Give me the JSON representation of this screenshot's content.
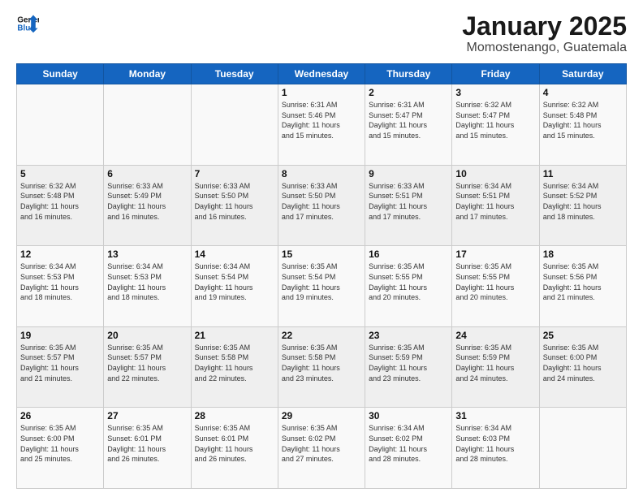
{
  "header": {
    "logo_line1": "General",
    "logo_line2": "Blue",
    "month_title": "January 2025",
    "location": "Momostenango, Guatemala"
  },
  "weekdays": [
    "Sunday",
    "Monday",
    "Tuesday",
    "Wednesday",
    "Thursday",
    "Friday",
    "Saturday"
  ],
  "weeks": [
    [
      {
        "day": "",
        "info": ""
      },
      {
        "day": "",
        "info": ""
      },
      {
        "day": "",
        "info": ""
      },
      {
        "day": "1",
        "info": "Sunrise: 6:31 AM\nSunset: 5:46 PM\nDaylight: 11 hours\nand 15 minutes."
      },
      {
        "day": "2",
        "info": "Sunrise: 6:31 AM\nSunset: 5:47 PM\nDaylight: 11 hours\nand 15 minutes."
      },
      {
        "day": "3",
        "info": "Sunrise: 6:32 AM\nSunset: 5:47 PM\nDaylight: 11 hours\nand 15 minutes."
      },
      {
        "day": "4",
        "info": "Sunrise: 6:32 AM\nSunset: 5:48 PM\nDaylight: 11 hours\nand 15 minutes."
      }
    ],
    [
      {
        "day": "5",
        "info": "Sunrise: 6:32 AM\nSunset: 5:48 PM\nDaylight: 11 hours\nand 16 minutes."
      },
      {
        "day": "6",
        "info": "Sunrise: 6:33 AM\nSunset: 5:49 PM\nDaylight: 11 hours\nand 16 minutes."
      },
      {
        "day": "7",
        "info": "Sunrise: 6:33 AM\nSunset: 5:50 PM\nDaylight: 11 hours\nand 16 minutes."
      },
      {
        "day": "8",
        "info": "Sunrise: 6:33 AM\nSunset: 5:50 PM\nDaylight: 11 hours\nand 17 minutes."
      },
      {
        "day": "9",
        "info": "Sunrise: 6:33 AM\nSunset: 5:51 PM\nDaylight: 11 hours\nand 17 minutes."
      },
      {
        "day": "10",
        "info": "Sunrise: 6:34 AM\nSunset: 5:51 PM\nDaylight: 11 hours\nand 17 minutes."
      },
      {
        "day": "11",
        "info": "Sunrise: 6:34 AM\nSunset: 5:52 PM\nDaylight: 11 hours\nand 18 minutes."
      }
    ],
    [
      {
        "day": "12",
        "info": "Sunrise: 6:34 AM\nSunset: 5:53 PM\nDaylight: 11 hours\nand 18 minutes."
      },
      {
        "day": "13",
        "info": "Sunrise: 6:34 AM\nSunset: 5:53 PM\nDaylight: 11 hours\nand 18 minutes."
      },
      {
        "day": "14",
        "info": "Sunrise: 6:34 AM\nSunset: 5:54 PM\nDaylight: 11 hours\nand 19 minutes."
      },
      {
        "day": "15",
        "info": "Sunrise: 6:35 AM\nSunset: 5:54 PM\nDaylight: 11 hours\nand 19 minutes."
      },
      {
        "day": "16",
        "info": "Sunrise: 6:35 AM\nSunset: 5:55 PM\nDaylight: 11 hours\nand 20 minutes."
      },
      {
        "day": "17",
        "info": "Sunrise: 6:35 AM\nSunset: 5:55 PM\nDaylight: 11 hours\nand 20 minutes."
      },
      {
        "day": "18",
        "info": "Sunrise: 6:35 AM\nSunset: 5:56 PM\nDaylight: 11 hours\nand 21 minutes."
      }
    ],
    [
      {
        "day": "19",
        "info": "Sunrise: 6:35 AM\nSunset: 5:57 PM\nDaylight: 11 hours\nand 21 minutes."
      },
      {
        "day": "20",
        "info": "Sunrise: 6:35 AM\nSunset: 5:57 PM\nDaylight: 11 hours\nand 22 minutes."
      },
      {
        "day": "21",
        "info": "Sunrise: 6:35 AM\nSunset: 5:58 PM\nDaylight: 11 hours\nand 22 minutes."
      },
      {
        "day": "22",
        "info": "Sunrise: 6:35 AM\nSunset: 5:58 PM\nDaylight: 11 hours\nand 23 minutes."
      },
      {
        "day": "23",
        "info": "Sunrise: 6:35 AM\nSunset: 5:59 PM\nDaylight: 11 hours\nand 23 minutes."
      },
      {
        "day": "24",
        "info": "Sunrise: 6:35 AM\nSunset: 5:59 PM\nDaylight: 11 hours\nand 24 minutes."
      },
      {
        "day": "25",
        "info": "Sunrise: 6:35 AM\nSunset: 6:00 PM\nDaylight: 11 hours\nand 24 minutes."
      }
    ],
    [
      {
        "day": "26",
        "info": "Sunrise: 6:35 AM\nSunset: 6:00 PM\nDaylight: 11 hours\nand 25 minutes."
      },
      {
        "day": "27",
        "info": "Sunrise: 6:35 AM\nSunset: 6:01 PM\nDaylight: 11 hours\nand 26 minutes."
      },
      {
        "day": "28",
        "info": "Sunrise: 6:35 AM\nSunset: 6:01 PM\nDaylight: 11 hours\nand 26 minutes."
      },
      {
        "day": "29",
        "info": "Sunrise: 6:35 AM\nSunset: 6:02 PM\nDaylight: 11 hours\nand 27 minutes."
      },
      {
        "day": "30",
        "info": "Sunrise: 6:34 AM\nSunset: 6:02 PM\nDaylight: 11 hours\nand 28 minutes."
      },
      {
        "day": "31",
        "info": "Sunrise: 6:34 AM\nSunset: 6:03 PM\nDaylight: 11 hours\nand 28 minutes."
      },
      {
        "day": "",
        "info": ""
      }
    ]
  ]
}
